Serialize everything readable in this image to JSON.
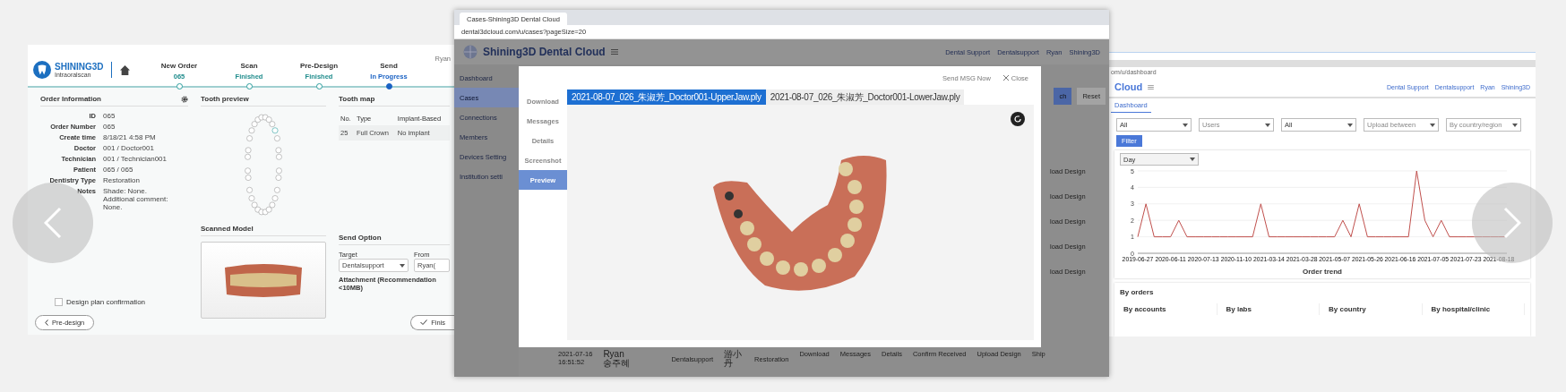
{
  "left_slide": {
    "logo": {
      "title": "SHINING3D",
      "subtitle": "Intraoralscan"
    },
    "user": "Ryan",
    "steps": [
      {
        "title": "New Order",
        "status": "065",
        "current": false
      },
      {
        "title": "Scan",
        "status": "Finished",
        "current": false
      },
      {
        "title": "Pre-Design",
        "status": "Finished",
        "current": false
      },
      {
        "title": "Send",
        "status": "In Progress",
        "current": true
      }
    ],
    "order_info": {
      "title": "Order Information",
      "fields": [
        {
          "label": "ID",
          "value": "065"
        },
        {
          "label": "Order Number",
          "value": "065"
        },
        {
          "label": "Create time",
          "value": "8/18/21 4:58 PM"
        },
        {
          "label": "Doctor",
          "value": "001 / Doctor001"
        },
        {
          "label": "Technician",
          "value": "001 / Technician001"
        },
        {
          "label": "Patient",
          "value": "065 / 065"
        },
        {
          "label": "Dentistry Type",
          "value": "Restoration"
        },
        {
          "label": "Notes",
          "value": "Shade: None.\nAdditional comment: None."
        }
      ]
    },
    "tooth_preview": {
      "title": "Tooth preview"
    },
    "tooth_map": {
      "title": "Tooth map",
      "columns": [
        "No.",
        "Type",
        "Implant-Based"
      ],
      "rows": [
        [
          "25",
          "Full Crown",
          "No implant"
        ]
      ]
    },
    "scanned_model": {
      "title": "Scanned Model"
    },
    "send_option": {
      "title": "Send Option",
      "target_label": "Target",
      "target_value": "Dentalsupport",
      "from_label": "From",
      "from_value": "Ryan(",
      "attachment": "Attachment (Recommendation <10MB)"
    },
    "confirmation": {
      "label": "Design plan confirmation",
      "checked": false
    },
    "back_button": "Pre-design",
    "finish_button": "Finis"
  },
  "center_slide": {
    "browser": {
      "tab_title": "Cases-Shining3D Dental Cloud",
      "url": "dental3dcloud.com/u/cases?pageSize=20"
    },
    "app_title": "Shining3D Dental Cloud",
    "breadcrumb": [
      "Dental Support",
      "Dentalsupport",
      "Ryan"
    ],
    "user": "Shining3D",
    "sidebar": [
      {
        "label": "Dashboard",
        "selected": false
      },
      {
        "label": "Cases",
        "selected": true
      },
      {
        "label": "Connections",
        "selected": false
      },
      {
        "label": "Members",
        "selected": false
      },
      {
        "label": "Devices Setting",
        "selected": false
      },
      {
        "label": "Institution setti",
        "selected": false
      }
    ],
    "search_button": "ch",
    "reset_button": "Reset",
    "row_actions": [
      "load Design",
      "load Design",
      "load Design",
      "load Design",
      "load Design"
    ],
    "modal": {
      "send_button": "Send MSG Now",
      "close_button": "Close",
      "side_tabs": [
        {
          "label": "Download",
          "selected": false
        },
        {
          "label": "Messages",
          "selected": false
        },
        {
          "label": "Details",
          "selected": false
        },
        {
          "label": "Screenshot",
          "selected": false
        },
        {
          "label": "Preview",
          "selected": true
        }
      ],
      "file_tabs": [
        {
          "label": "2021-08-07_026_朱淑芳_Doctor001-UpperJaw.ply",
          "selected": true
        },
        {
          "label": "2021-08-07_026_朱淑芳_Doctor001-LowerJaw.ply",
          "selected": false
        }
      ]
    },
    "last_row": {
      "time": "2021-07-16\n16:51:52",
      "creator": "Ryan\n송주혜",
      "lab": "Dentalsupport",
      "patient": "游小丹",
      "type": "Restoration",
      "actions": [
        "Download",
        "Messages",
        "Details",
        "Confirm Received",
        "Upload Design",
        "Ship"
      ]
    }
  },
  "right_slide": {
    "url": "om/u/dashboard",
    "app_title": "Cloud",
    "breadcrumb": [
      "Dental Support",
      "Dentalsupport",
      "Ryan"
    ],
    "user": "Shining3D",
    "tab": "Dashboard",
    "filters": [
      {
        "value": "All"
      },
      {
        "placeholder": "Users"
      },
      {
        "value": "All"
      },
      {
        "placeholder": "Upload between"
      },
      {
        "placeholder": "By country/region"
      }
    ],
    "filter_button": "Filter",
    "dimension": "Day",
    "chart_data": {
      "type": "line",
      "title": "Order trend",
      "categories": [
        "2019-06-27",
        null,
        null,
        null,
        "2020-06-11",
        null,
        null,
        null,
        "2020-07-13",
        null,
        null,
        null,
        "2020-11-10",
        null,
        null,
        null,
        "2021-03-14",
        null,
        null,
        null,
        "2021-03-28",
        null,
        null,
        null,
        "2021-05-07",
        null,
        null,
        null,
        "2021-05-26",
        null,
        null,
        null,
        "2021-06-16",
        null,
        null,
        null,
        "2021-07-05",
        null,
        null,
        null,
        "2021-07-23",
        null,
        null,
        null,
        "2021-08-18",
        null
      ],
      "ylim": [
        0,
        5
      ],
      "yticks": [
        0,
        1,
        2,
        3,
        4,
        5
      ],
      "grid": true,
      "series": [
        {
          "color": "#c0504d",
          "values": [
            1,
            3,
            1,
            1,
            1,
            2,
            1,
            1,
            1,
            1,
            1,
            1,
            1,
            1,
            1,
            3,
            1,
            1,
            1,
            1,
            1,
            1,
            1,
            1,
            1,
            2,
            1,
            3,
            1,
            1,
            1,
            1,
            1,
            1,
            5,
            2,
            1,
            2,
            1,
            1,
            1,
            1,
            1,
            1,
            1,
            1
          ]
        }
      ]
    },
    "orders_title": "By orders",
    "cards": [
      "By accounts",
      "By labs",
      "By country",
      "By hospital/clinic"
    ]
  }
}
